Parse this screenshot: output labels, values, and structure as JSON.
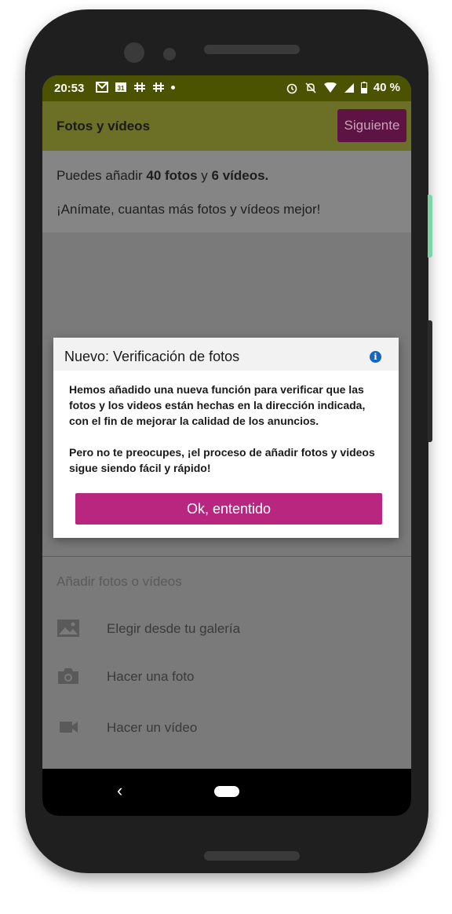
{
  "status_bar": {
    "time": "20:53",
    "battery": "40 %"
  },
  "app_bar": {
    "title": "Fotos y vídeos",
    "next_label": "Siguiente"
  },
  "intro": {
    "prefix": "Puedes añadir ",
    "photos": "40 fotos",
    "middle": " y ",
    "videos": "6 vídeos.",
    "encouragement": "¡Anímate, cuantas más fotos y vídeos mejor!"
  },
  "add_section": {
    "title": "Añadir fotos o vídeos",
    "items": [
      {
        "label": "Elegir desde tu galería",
        "icon": "image-icon"
      },
      {
        "label": "Hacer una foto",
        "icon": "camera-icon"
      },
      {
        "label": "Hacer un vídeo",
        "icon": "video-camera-icon"
      }
    ]
  },
  "dialog": {
    "title": "Nuevo: Verificación de fotos",
    "paragraph1": "Hemos añadido una nueva función para verificar que las fotos y los videos están hechas en la dirección indicada, con el fin de mejorar la calidad de los anuncios.",
    "paragraph2": "Pero no te preocupes, ¡el proceso de añadir fotos y videos sigue siendo fácil y rápido!",
    "ok_label": "Ok, ententido"
  },
  "colors": {
    "status_bar": "#4c5300",
    "app_bar": "#6b7026",
    "primary_button": "#b8267f",
    "info": "#1565c0"
  }
}
